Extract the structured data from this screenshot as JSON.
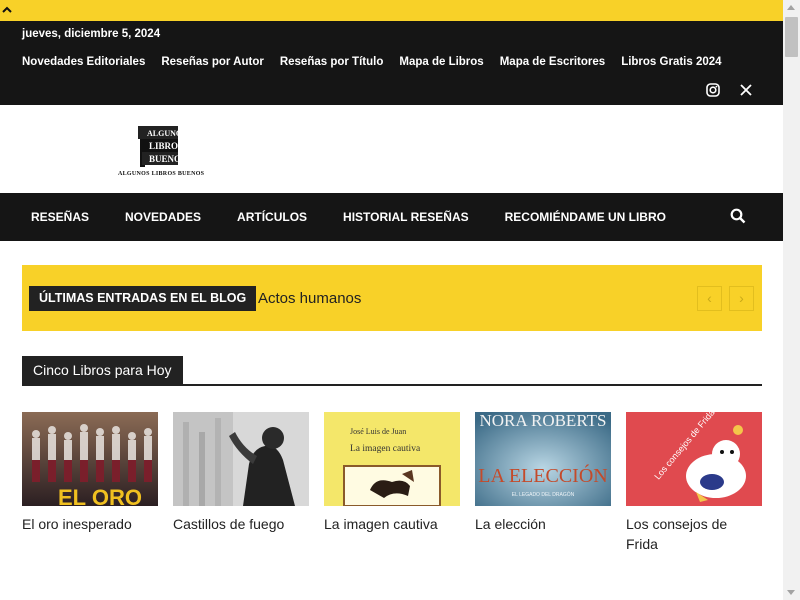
{
  "top_bar": {
    "icon": "chevron-up-icon",
    "color": "#f8d128"
  },
  "header": {
    "date": "jueves, diciembre 5, 2024",
    "links": [
      "Novedades Editoriales",
      "Reseñas por Autor",
      "Reseñas por Título",
      "Mapa de Libros",
      "Mapa de Escritores",
      "Libros Gratis 2024"
    ],
    "social_icons": [
      "instagram-icon",
      "x-twitter-icon"
    ]
  },
  "logo": {
    "text_lines": [
      "ALGUNOS",
      "LIBROS",
      "BUENOS"
    ],
    "caption": "ALGUNOS LIBROS BUENOS"
  },
  "main_nav": {
    "items": [
      "RESEÑAS",
      "NOVEDADES",
      "ARTÍCULOS",
      "HISTORIAL RESEÑAS",
      "RECOMIÉNDAME UN LIBRO"
    ],
    "search_icon": "search-icon"
  },
  "ticker": {
    "label": "ÚLTIMAS ENTRADAS EN EL BLOG",
    "current": "Actos humanos",
    "prev_icon": "chevron-left-icon",
    "next_icon": "chevron-right-icon"
  },
  "section": {
    "title": "Cinco Libros para Hoy"
  },
  "books": [
    {
      "title": "El oro inesperado",
      "cover_text": "EL ORO"
    },
    {
      "title": "Castillos de fuego",
      "cover_text": ""
    },
    {
      "title": "La imagen cautiva",
      "cover_author": "José Luis de Juan",
      "cover_text": "La imagen cautiva"
    },
    {
      "title": "La elección",
      "cover_author": "NORA ROBERTS",
      "cover_text": "LA ELECCIÓN",
      "cover_sub": "EL LEGADO DEL DRAGÓN"
    },
    {
      "title": "Los consejos de Frida",
      "cover_text": "Los consejos de Frida"
    }
  ],
  "colors": {
    "accent": "#f8d128",
    "dark": "#151515"
  }
}
